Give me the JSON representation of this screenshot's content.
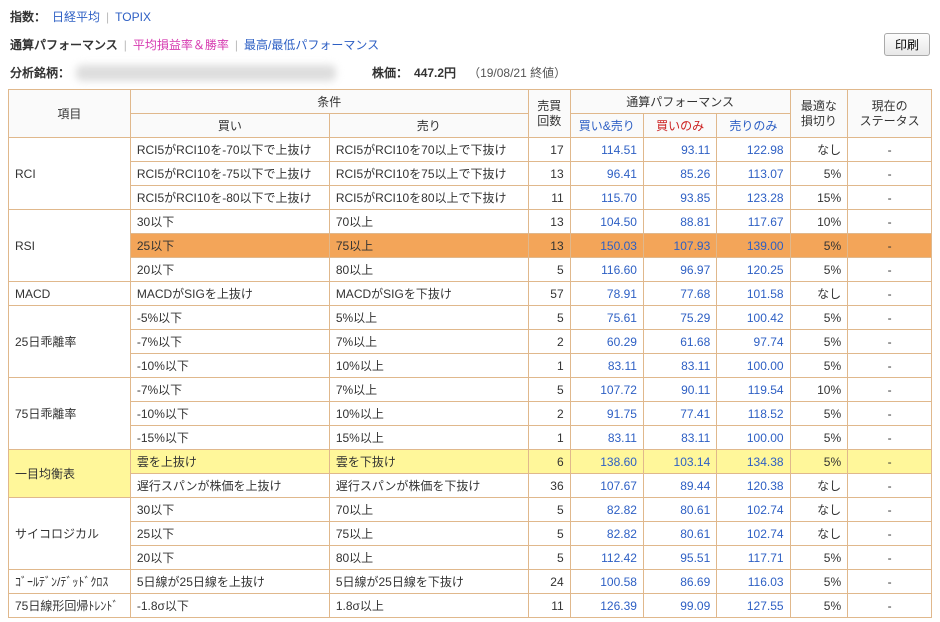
{
  "topbar": {
    "label": "指数：",
    "nikkei": "日経平均",
    "sep": "|",
    "topix": "TOPIX"
  },
  "tabbar": {
    "tab1": "通算パフォーマンス",
    "tab2": "平均損益率＆勝率",
    "tab3": "最高/最低パフォーマンス",
    "print": "印刷"
  },
  "info": {
    "label": "分析銘柄：",
    "price_label": "株価：",
    "price_value": "447.2円",
    "price_date": "（19/08/21 終値）"
  },
  "headers": {
    "item": "項目",
    "cond": "条件",
    "buy": "買い",
    "sell": "売り",
    "trades": "売買\n回数",
    "perf": "通算パフォーマンス",
    "perf_both": "買い&売り",
    "perf_buy": "買いのみ",
    "perf_sell": "売りのみ",
    "loss": "最適な\n損切り",
    "status": "現在の\nステータス"
  },
  "groups": [
    {
      "cat": "RCI",
      "rows": [
        {
          "buy": "RCI5がRCI10を-70以下で上抜け",
          "sell": "RCI5がRCI10を70以上で下抜け",
          "n": "17",
          "v": [
            "114.51",
            "93.11",
            "122.98"
          ],
          "loss": "なし",
          "st": "-"
        },
        {
          "buy": "RCI5がRCI10を-75以下で上抜け",
          "sell": "RCI5がRCI10を75以上で下抜け",
          "n": "13",
          "v": [
            "96.41",
            "85.26",
            "113.07"
          ],
          "loss": "5%",
          "st": "-"
        },
        {
          "buy": "RCI5がRCI10を-80以下で上抜け",
          "sell": "RCI5がRCI10を80以上で下抜け",
          "n": "11",
          "v": [
            "115.70",
            "93.85",
            "123.28"
          ],
          "loss": "15%",
          "st": "-"
        }
      ]
    },
    {
      "cat": "RSI",
      "rows": [
        {
          "buy": "30以下",
          "sell": "70以上",
          "n": "13",
          "v": [
            "104.50",
            "88.81",
            "117.67"
          ],
          "loss": "10%",
          "st": "-"
        },
        {
          "buy": "25以下",
          "sell": "75以上",
          "n": "13",
          "v": [
            "150.03",
            "107.93",
            "139.00"
          ],
          "loss": "5%",
          "st": "-",
          "hl": "orange"
        },
        {
          "buy": "20以下",
          "sell": "80以上",
          "n": "5",
          "v": [
            "116.60",
            "96.97",
            "120.25"
          ],
          "loss": "5%",
          "st": "-"
        }
      ]
    },
    {
      "cat": "MACD",
      "rows": [
        {
          "buy": "MACDがSIGを上抜け",
          "sell": "MACDがSIGを下抜け",
          "n": "57",
          "v": [
            "78.91",
            "77.68",
            "101.58"
          ],
          "loss": "なし",
          "st": "-"
        }
      ]
    },
    {
      "cat": "25日乖離率",
      "rows": [
        {
          "buy": "-5%以下",
          "sell": "5%以上",
          "n": "5",
          "v": [
            "75.61",
            "75.29",
            "100.42"
          ],
          "loss": "5%",
          "st": "-"
        },
        {
          "buy": "-7%以下",
          "sell": "7%以上",
          "n": "2",
          "v": [
            "60.29",
            "61.68",
            "97.74"
          ],
          "loss": "5%",
          "st": "-"
        },
        {
          "buy": "-10%以下",
          "sell": "10%以上",
          "n": "1",
          "v": [
            "83.11",
            "83.11",
            "100.00"
          ],
          "loss": "5%",
          "st": "-"
        }
      ]
    },
    {
      "cat": "75日乖離率",
      "rows": [
        {
          "buy": "-7%以下",
          "sell": "7%以上",
          "n": "5",
          "v": [
            "107.72",
            "90.11",
            "119.54"
          ],
          "loss": "10%",
          "st": "-"
        },
        {
          "buy": "-10%以下",
          "sell": "10%以上",
          "n": "2",
          "v": [
            "91.75",
            "77.41",
            "118.52"
          ],
          "loss": "5%",
          "st": "-"
        },
        {
          "buy": "-15%以下",
          "sell": "15%以上",
          "n": "1",
          "v": [
            "83.11",
            "83.11",
            "100.00"
          ],
          "loss": "5%",
          "st": "-"
        }
      ]
    },
    {
      "cat": "一目均衡表",
      "rows": [
        {
          "buy": "雲を上抜け",
          "sell": "雲を下抜け",
          "n": "6",
          "v": [
            "138.60",
            "103.14",
            "134.38"
          ],
          "loss": "5%",
          "st": "-",
          "hl": "yellow"
        },
        {
          "buy": "遅行スパンが株価を上抜け",
          "sell": "遅行スパンが株価を下抜け",
          "n": "36",
          "v": [
            "107.67",
            "89.44",
            "120.38"
          ],
          "loss": "なし",
          "st": "-"
        }
      ]
    },
    {
      "cat": "サイコロジカル",
      "rows": [
        {
          "buy": "30以下",
          "sell": "70以上",
          "n": "5",
          "v": [
            "82.82",
            "80.61",
            "102.74"
          ],
          "loss": "なし",
          "st": "-"
        },
        {
          "buy": "25以下",
          "sell": "75以上",
          "n": "5",
          "v": [
            "82.82",
            "80.61",
            "102.74"
          ],
          "loss": "なし",
          "st": "-"
        },
        {
          "buy": "20以下",
          "sell": "80以上",
          "n": "5",
          "v": [
            "112.42",
            "95.51",
            "117.71"
          ],
          "loss": "5%",
          "st": "-"
        }
      ]
    },
    {
      "cat": "ｺﾞｰﾙﾃﾞﾝ/ﾃﾞｯﾄﾞｸﾛｽ",
      "rows": [
        {
          "buy": "5日線が25日線を上抜け",
          "sell": "5日線が25日線を下抜け",
          "n": "24",
          "v": [
            "100.58",
            "86.69",
            "116.03"
          ],
          "loss": "5%",
          "st": "-"
        }
      ]
    },
    {
      "cat": "75日線形回帰ﾄﾚﾝﾄﾞ",
      "rows": [
        {
          "buy": "-1.8σ以下",
          "sell": "1.8σ以上",
          "n": "11",
          "v": [
            "126.39",
            "99.09",
            "127.55"
          ],
          "loss": "5%",
          "st": "-"
        }
      ]
    }
  ]
}
